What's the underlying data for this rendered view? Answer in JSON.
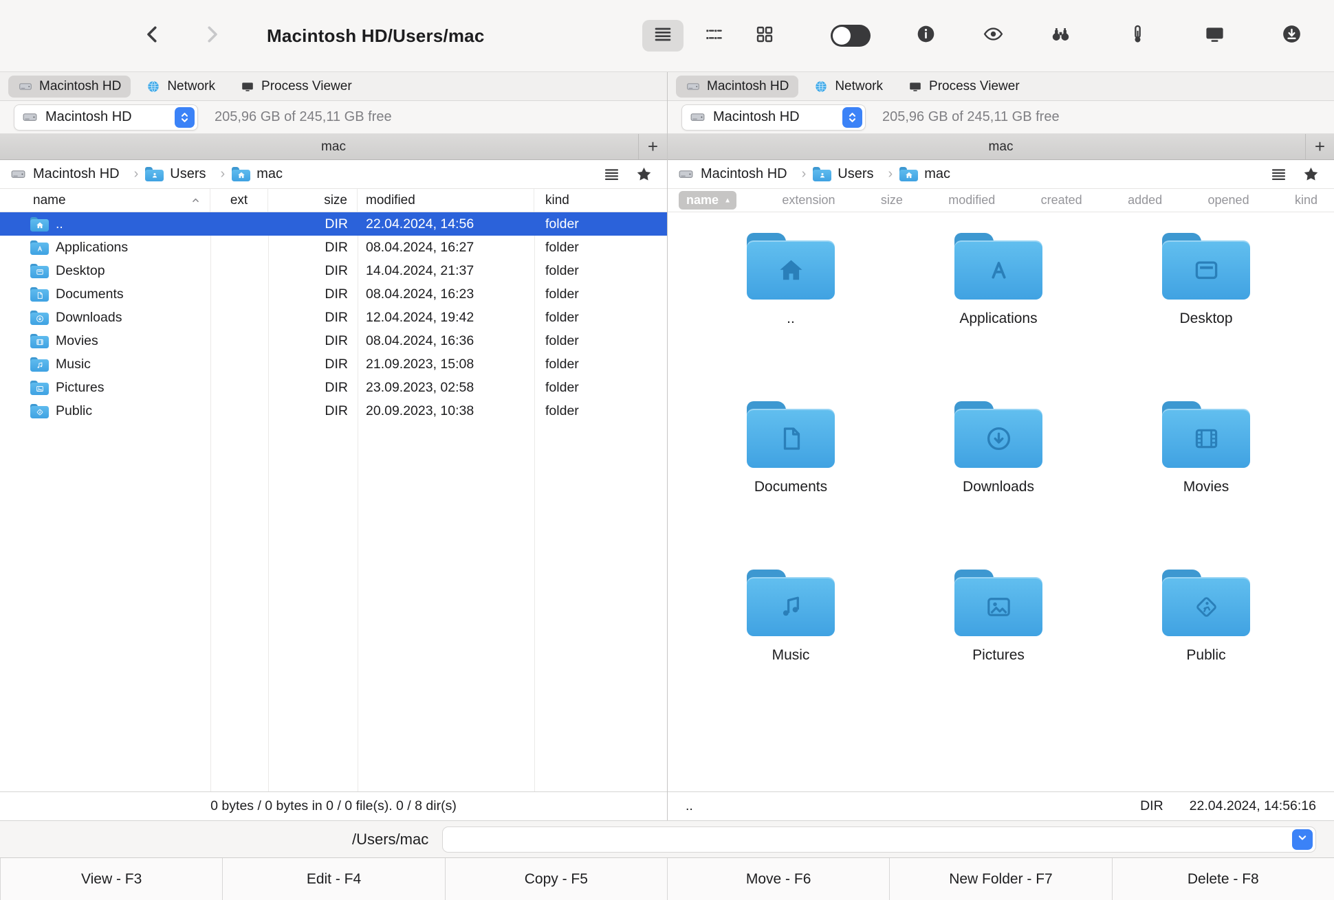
{
  "window_title": "Macintosh HD/Users/mac",
  "toolbar": {
    "icons": [
      "back",
      "forward",
      "view-list",
      "view-detail",
      "view-grid",
      "dark-toggle",
      "info",
      "eye",
      "binoculars",
      "archive",
      "screen-sharing",
      "download"
    ]
  },
  "tabs": [
    {
      "label": "Macintosh HD",
      "icon": "drive",
      "active": true
    },
    {
      "label": "Network",
      "icon": "globe",
      "active": false
    },
    {
      "label": "Process Viewer",
      "icon": "monitor",
      "active": false
    }
  ],
  "drive_selector": {
    "value": "Macintosh HD",
    "free_text": "205,96 GB of 245,11 GB free"
  },
  "path_tab": {
    "label": "mac",
    "add_label": "+"
  },
  "breadcrumb": [
    {
      "label": "Macintosh HD",
      "icon": "drive",
      "folder": false
    },
    {
      "label": "Users",
      "icon": "users",
      "folder": true
    },
    {
      "label": "mac",
      "icon": "home",
      "folder": true
    }
  ],
  "left_pane": {
    "columns": {
      "name": "name",
      "ext": "ext",
      "size": "size",
      "modified": "modified",
      "kind": "kind"
    },
    "rows": [
      {
        "name": "..",
        "icon": "home",
        "size": "DIR",
        "modified": "22.04.2024, 14:56",
        "kind": "folder",
        "selected": true
      },
      {
        "name": "Applications",
        "icon": "appstore",
        "size": "DIR",
        "modified": "08.04.2024, 16:27",
        "kind": "folder"
      },
      {
        "name": "Desktop",
        "icon": "desktop",
        "size": "DIR",
        "modified": "14.04.2024, 21:37",
        "kind": "folder"
      },
      {
        "name": "Documents",
        "icon": "document",
        "size": "DIR",
        "modified": "08.04.2024, 16:23",
        "kind": "folder"
      },
      {
        "name": "Downloads",
        "icon": "downloads",
        "size": "DIR",
        "modified": "12.04.2024, 19:42",
        "kind": "folder"
      },
      {
        "name": "Movies",
        "icon": "film",
        "size": "DIR",
        "modified": "08.04.2024, 16:36",
        "kind": "folder"
      },
      {
        "name": "Music",
        "icon": "music",
        "size": "DIR",
        "modified": "21.09.2023, 15:08",
        "kind": "folder"
      },
      {
        "name": "Pictures",
        "icon": "picture",
        "size": "DIR",
        "modified": "23.09.2023, 02:58",
        "kind": "folder"
      },
      {
        "name": "Public",
        "icon": "public",
        "size": "DIR",
        "modified": "20.09.2023, 10:38",
        "kind": "folder"
      }
    ],
    "status": "0 bytes / 0 bytes in 0 / 0 file(s). 0 / 8 dir(s)"
  },
  "right_pane": {
    "columns": [
      {
        "label": "name",
        "sorted": true
      },
      {
        "label": "extension"
      },
      {
        "label": "size"
      },
      {
        "label": "modified"
      },
      {
        "label": "created"
      },
      {
        "label": "added"
      },
      {
        "label": "opened"
      },
      {
        "label": "kind"
      }
    ],
    "items": [
      {
        "label": "..",
        "icon": "home"
      },
      {
        "label": "Applications",
        "icon": "appstore"
      },
      {
        "label": "Desktop",
        "icon": "desktop"
      },
      {
        "label": "Documents",
        "icon": "document"
      },
      {
        "label": "Downloads",
        "icon": "downloads"
      },
      {
        "label": "Movies",
        "icon": "film"
      },
      {
        "label": "Music",
        "icon": "music"
      },
      {
        "label": "Pictures",
        "icon": "picture"
      },
      {
        "label": "Public",
        "icon": "public"
      }
    ],
    "status_name": "..",
    "status_dir": "DIR",
    "status_time": "22.04.2024, 14:56:16"
  },
  "command_line": {
    "label": "/Users/mac",
    "value": ""
  },
  "function_bar": [
    {
      "label": "View - F3"
    },
    {
      "label": "Edit - F4"
    },
    {
      "label": "Copy - F5"
    },
    {
      "label": "Move - F6"
    },
    {
      "label": "New Folder - F7"
    },
    {
      "label": "Delete - F8"
    }
  ]
}
